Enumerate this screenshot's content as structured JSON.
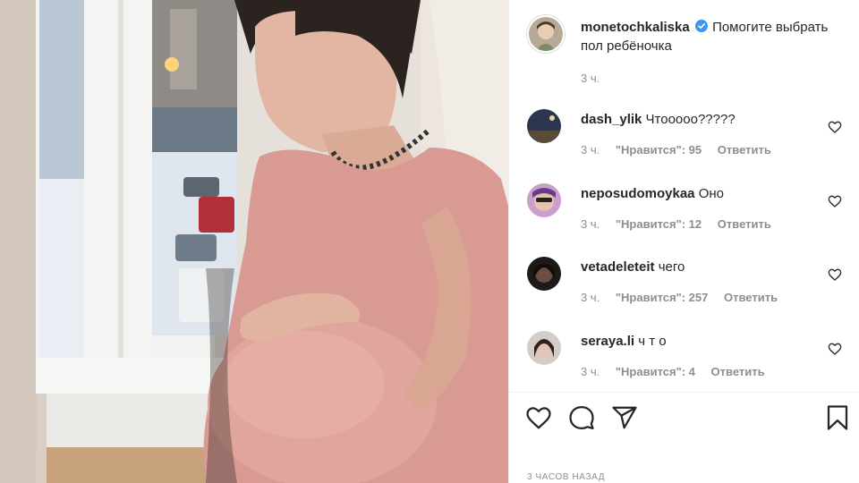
{
  "post": {
    "photo_alt": "",
    "caption": {
      "username": "monetochkaliska",
      "verified": true,
      "text": "Помогите выбрать пол ребёночка",
      "time": "3 ч."
    },
    "comments": [
      {
        "username": "dash_ylik",
        "text": "Чтооооо?????",
        "time": "3 ч.",
        "likes": "\"Нравится\": 95",
        "reply": "Ответить",
        "avatar_color": "#3a4a6a"
      },
      {
        "username": "neposudomoykaa",
        "text": "Оно",
        "time": "3 ч.",
        "likes": "\"Нравится\": 12",
        "reply": "Ответить",
        "avatar_color": "#b58ab8"
      },
      {
        "username": "vetadeleteit",
        "text": "чего",
        "time": "3 ч.",
        "likes": "\"Нравится\": 257",
        "reply": "Ответить",
        "avatar_color": "#2b2420"
      },
      {
        "username": "seraya.li",
        "text": "ч т о",
        "time": "3 ч.",
        "likes": "\"Нравится\": 4",
        "reply": "Ответить",
        "avatar_color": "#3a3030"
      }
    ],
    "actions": {
      "like_icon": "heart-icon",
      "comment_icon": "comment-icon",
      "share_icon": "share-icon",
      "save_icon": "bookmark-icon"
    },
    "posted_ago": "3 часов назад"
  },
  "colors": {
    "verified": "#3897f0",
    "text": "#262626",
    "muted": "#8e8e8e",
    "divider": "#efefef"
  }
}
